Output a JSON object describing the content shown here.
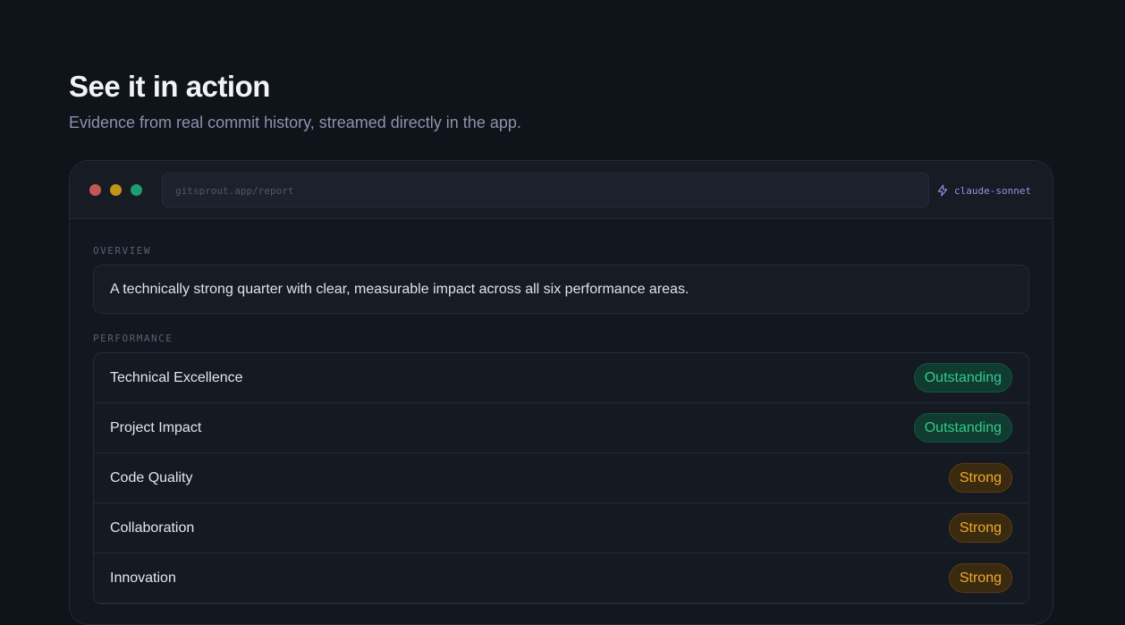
{
  "section": {
    "title": "See it in action",
    "subtitle": "Evidence from real commit history, streamed directly in the app."
  },
  "window": {
    "url": "gitsprout.app/report",
    "model": "claude-sonnet",
    "model_icon": "bolt-icon"
  },
  "report": {
    "overview_label": "OVERVIEW",
    "overview_text": "A technically strong quarter with clear, measurable impact across all six performance areas.",
    "performance_label": "PERFORMANCE",
    "performance": [
      {
        "name": "Technical Excellence",
        "rating": "Outstanding"
      },
      {
        "name": "Project Impact",
        "rating": "Outstanding"
      },
      {
        "name": "Code Quality",
        "rating": "Strong"
      },
      {
        "name": "Collaboration",
        "rating": "Strong"
      },
      {
        "name": "Innovation",
        "rating": "Strong"
      }
    ]
  },
  "colors": {
    "outstanding": "#36c98b",
    "strong": "#f0a92a",
    "model_accent": "#9a8ee8"
  }
}
